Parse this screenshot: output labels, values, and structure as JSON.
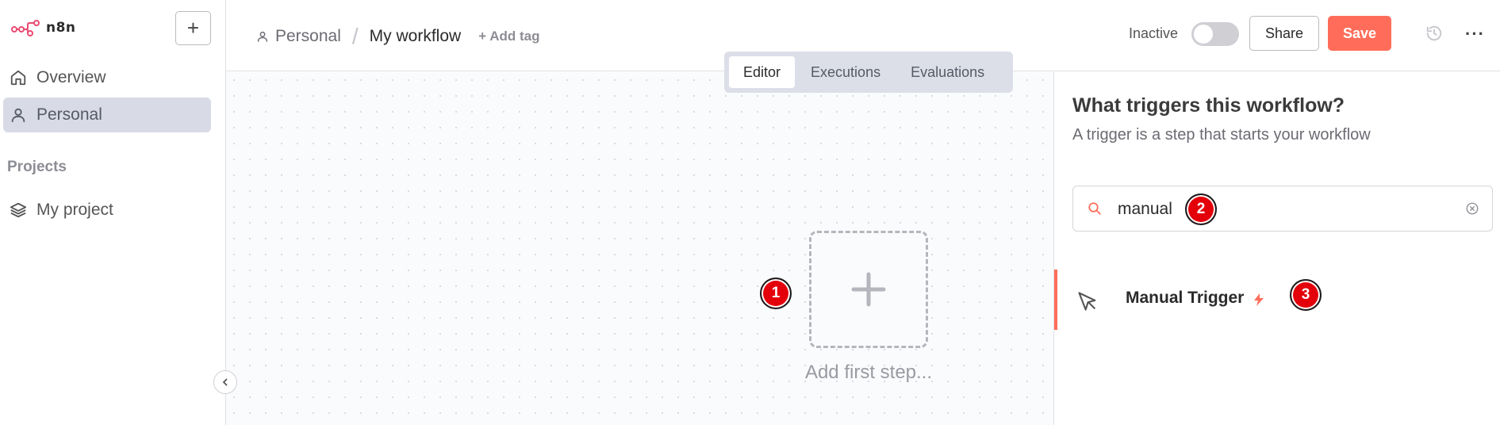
{
  "sidebar": {
    "brand": "n8n",
    "new_button": "+",
    "nav": [
      {
        "label": "Overview",
        "icon": "home-icon"
      },
      {
        "label": "Personal",
        "icon": "user-icon",
        "active": true
      }
    ],
    "projects_title": "Projects",
    "projects": [
      {
        "label": "My project",
        "icon": "layers-icon"
      }
    ]
  },
  "header": {
    "project": "Personal",
    "separator": "/",
    "workflow_name": "My workflow",
    "add_tag": "+ Add tag",
    "status": "Inactive",
    "active": false,
    "share_label": "Share",
    "save_label": "Save",
    "more": "···"
  },
  "tabs": [
    {
      "label": "Editor",
      "active": true
    },
    {
      "label": "Executions",
      "active": false
    },
    {
      "label": "Evaluations",
      "active": false
    }
  ],
  "canvas": {
    "add_label": "Add first step...",
    "add_symbol": "+"
  },
  "panel": {
    "title": "What triggers this workflow?",
    "subtitle": "A trigger is a step that starts your workflow",
    "search_value": "manual",
    "results": [
      {
        "label": "Manual Trigger",
        "icon": "cursor-icon",
        "badge": "bolt-icon"
      }
    ]
  },
  "markers": [
    "1",
    "2",
    "3"
  ],
  "colors": {
    "accent": "#ff6d5a",
    "marker": "#e3000b",
    "active_nav": "#d8dbe6"
  }
}
